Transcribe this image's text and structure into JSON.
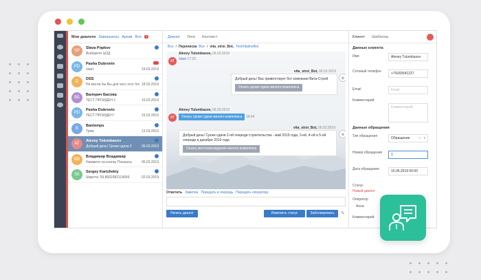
{
  "colors": {
    "accent": "#3a7bc8",
    "brand_green": "#2bbf9a",
    "selected_row": "#6f8fb5",
    "nav_bg": "#3b4251"
  },
  "dialogs": {
    "tabs": {
      "mine": "Мои диалоги",
      "closed": "Завершены",
      "archive": "Архив",
      "all": "Все",
      "all_badge": "7"
    },
    "items": [
      {
        "initials": "SP",
        "color": "#e6a07a",
        "name": "Slava Popkov",
        "preview": "Выберите ЦОД",
        "date": "",
        "badge": "blue"
      },
      {
        "initials": "PD",
        "color": "#7ab7e6",
        "name": "Pasha Dubrovin",
        "preview": "/start",
        "date": "19.03.2019",
        "badge": "red"
      },
      {
        "initials": "D",
        "color": "#f0b35c",
        "name": "DSS",
        "preview": "Не могли бы Вы для чего этот бот",
        "date": "18.03.2019",
        "badge": "blue"
      },
      {
        "initials": "ВБ",
        "color": "#b38fd1",
        "name": "Валерич Басова",
        "preview": "ТЕСТ ПРОЙДЕН 2",
        "date": "15.03.2019",
        "badge": "blue"
      },
      {
        "initials": "PD",
        "color": "#7ab7e6",
        "name": "Pasha Dubrovin",
        "preview": "ТЕСТ ПРОЙДЕН !",
        "date": "15.03.2019",
        "badge": "blue"
      },
      {
        "initials": "B",
        "color": "#7aa8e6",
        "name": "Bantemps",
        "preview": "Трям",
        "date": "13.03.2019",
        "badge": "blue"
      },
      {
        "initials": "AT",
        "color": "#e68a8a",
        "name": "Alexey Tulumbasov",
        "preview": "Добрый день! Сроки сдачи 2",
        "date": "06.03.2019",
        "badge": "blue",
        "selected": true
      },
      {
        "initials": "ВВ",
        "color": "#f0b35c",
        "name": "Владимир Владимир",
        "preview": "Нажмите на кнопку Показать",
        "date": "05.03.2019",
        "badge": "blue"
      },
      {
        "initials": "SK",
        "color": "#7ac98f",
        "name": "Sergey Kartzhekiy",
        "preview": "Широта: 59,8602082114556",
        "date": "02.03.2019",
        "badge": "blue"
      }
    ]
  },
  "chat": {
    "tabs": [
      "Диалог",
      "Логи",
      "Контекст"
    ],
    "breadcrumb": {
      "all": "Все",
      "chat": "Переписка",
      "sep": "/",
      "bot": "vita_stroi_Bot,",
      "channel": "TestVitalineBot"
    },
    "messages": {
      "m1_sender": "Alexey Tulumbasov,",
      "m1_date": "06.03.2019",
      "m1_text": "/start",
      "m1_time": "17:20",
      "m2_sender": "vita_stroi_Bot,",
      "m2_date": "06.03.2019",
      "m2_text": "Добрый день! Вас приветствует бот компании Вита-Строй",
      "m2_button": "Узнать сроки сдачи жилого комплекса",
      "m3_sender": "Alexey Tulumbasov,",
      "m3_date": "06.03.2019",
      "m3_text": "Узнать сроки сдачи жилого комплекса",
      "m3_time": "18:04",
      "m4_sender": "vita_stroi_Bot,",
      "m4_date": "06.03.2019",
      "m4_text": "Добрый день! Сроки сдачи 2-ой очереди строительства - май 2019 года, 3-ей, 4-ой и 5-ой очереди в декабре 2019 года",
      "m4_button": "Узнать местонахождение жилого комплекса"
    },
    "reply": {
      "label": "Ответить",
      "link1": "Заметка",
      "link2": "Передать в очередь",
      "link3": "Передать оператору"
    },
    "buttons": {
      "start": "Начать диалог",
      "change_status": "Изменить статус",
      "block": "Заблокировать"
    }
  },
  "client": {
    "tabs": [
      "Клиент",
      "Шаблоны"
    ],
    "section1": "Данные клиента",
    "name_label": "Имя",
    "name_value": "Alexey Tulumbasov",
    "phone_label": "Сотовый телефон",
    "phone_value": "+79183541227",
    "email_label": "Email",
    "email_placeholder": "Email",
    "comment_label": "Комментарий",
    "comment_placeholder": "Комментарий",
    "section2": "Данные обращения",
    "type_label": "Тип обращения",
    "type_value": "Обращение",
    "num_label": "Номер обращения",
    "num_value": "1",
    "date_label": "Дата обращения",
    "date_value": "15.05.2019 00:00",
    "status_label": "Статус",
    "status_value": "Новый диалог",
    "operator_label": "Оператор",
    "operator_value": "Анна",
    "comment2_label": "Комментарий"
  }
}
